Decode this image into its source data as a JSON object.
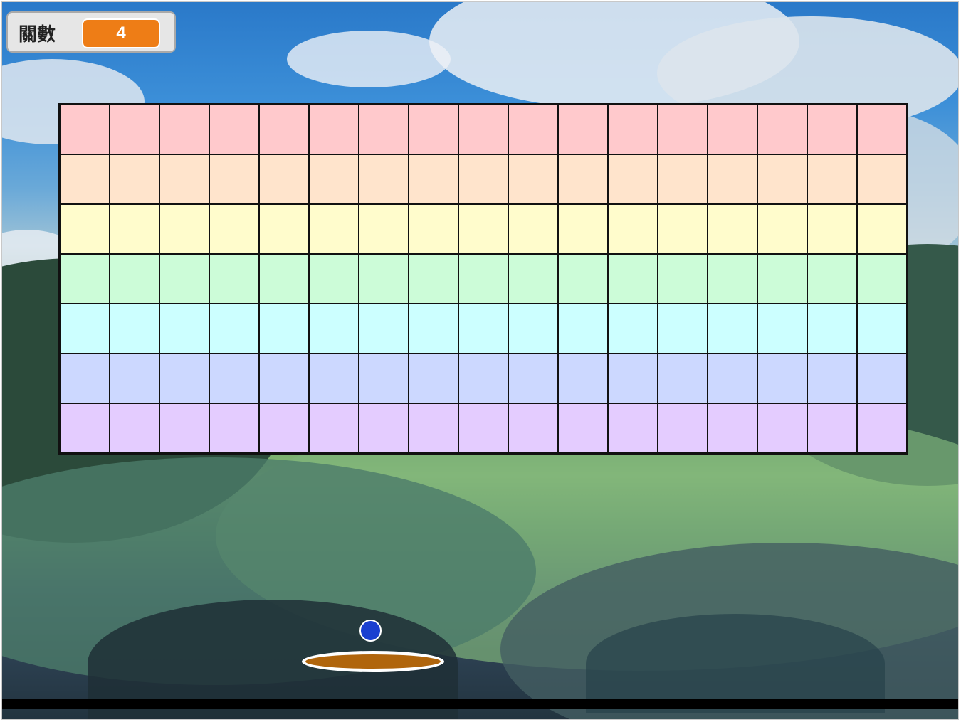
{
  "game": {
    "level_label": "關數",
    "level_value": "4"
  },
  "colors": {
    "brick_rows": [
      "#ffc9cc",
      "#ffe4cc",
      "#fffccc",
      "#ccfcd8",
      "#ccffff",
      "#ccd8ff",
      "#e4ccff"
    ],
    "ball": "#1a3fd0",
    "paddle": "#b0650c",
    "counter": "#ee7d16"
  },
  "bricks": {
    "rows": 7,
    "columns": 17
  }
}
